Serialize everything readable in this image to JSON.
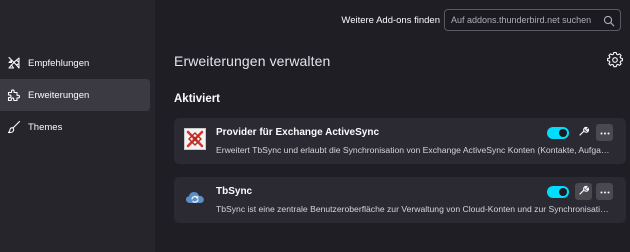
{
  "sidebar": {
    "items": [
      {
        "label": "Empfehlungen",
        "icon": "recommendations-icon"
      },
      {
        "label": "Erweiterungen",
        "icon": "extensions-icon",
        "selected": true
      },
      {
        "label": "Themes",
        "icon": "themes-brush-icon"
      }
    ]
  },
  "header": {
    "find_label": "Weitere Add-ons finden",
    "search_placeholder": "Auf addons.thunderbird.net suchen"
  },
  "main": {
    "title": "Erweiterungen verwalten",
    "section_title": "Aktiviert"
  },
  "addons": [
    {
      "name": "Provider für Exchange ActiveSync",
      "description": "Erweitert TbSync und erlaubt die Synchronisation von Exchange ActiveSync Konten (Kontakte, Aufgaben und Kalender).",
      "enabled": true,
      "icon": "exchange-activesync-icon"
    },
    {
      "name": "TbSync",
      "description": "TbSync ist eine zentrale Benutzeroberfläche zur Verwaltung von Cloud-Konten und zur Synchronisation ihrer Kontakt-, Aufgaben- und Kalenderdaten.",
      "enabled": true,
      "icon": "tbsync-sync-icon"
    }
  ],
  "colors": {
    "background": "#1f1e25",
    "sidebar": "#26252c",
    "card": "#2b2a33",
    "toggle_on": "#00ddff"
  }
}
